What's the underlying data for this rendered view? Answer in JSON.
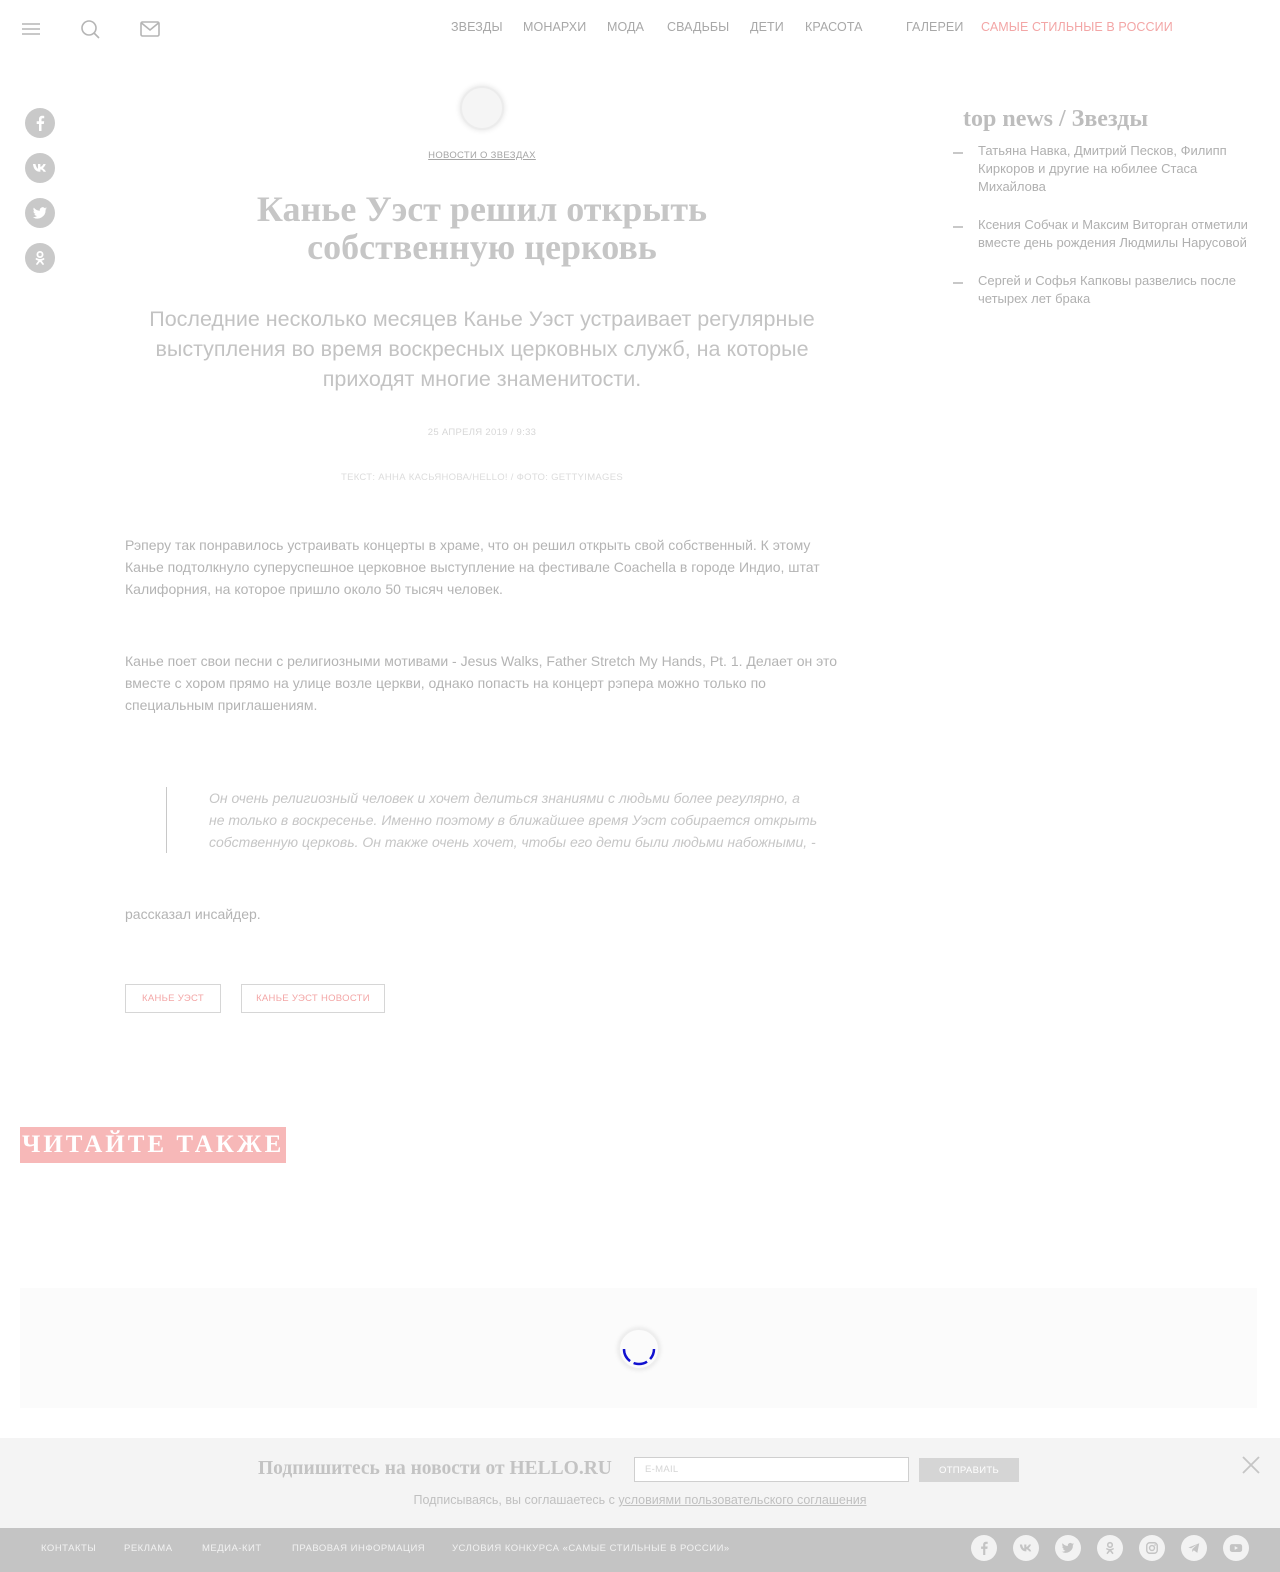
{
  "header": {
    "nav": [
      {
        "label": "ЗВЕЗДЫ",
        "accent": false
      },
      {
        "label": "МОНАРХИ",
        "accent": false
      },
      {
        "label": "МОДА",
        "accent": false
      },
      {
        "label": "СВАДЬБЫ",
        "accent": false
      },
      {
        "label": "ДЕТИ",
        "accent": false
      },
      {
        "label": "КРАСОТА",
        "accent": false
      },
      {
        "label": "ГАЛЕРЕИ",
        "accent": false
      },
      {
        "label": "САМЫЕ СТИЛЬНЫЕ В РОССИИ",
        "accent": true
      }
    ],
    "icons": [
      "menu-icon",
      "search-icon",
      "mail-icon"
    ]
  },
  "share_icons": [
    "facebook-icon",
    "vk-icon",
    "twitter-icon",
    "odnoklassniki-icon"
  ],
  "article": {
    "rubric": "НОВОСТИ О ЗВЕЗДАХ",
    "title": "Канье Уэст решил открыть собственную церковь",
    "lead": "Последние несколько месяцев Канье Уэст устраивает регулярные выступления во время воскресных церковных служб, на которые приходят многие знаменитости.",
    "date": "25 АПРЕЛЯ 2019 / 9:33",
    "credits": "ТЕКСТ: АННА КАСЬЯНОВА/HELLO! / ФОТО: GETTYIMAGES",
    "paragraph_1": "Рэперу так понравилось устраивать концерты в храме, что он решил открыть свой собственный. К этому Канье подтолкнуло суперуспешное церковное выступление на фестивале Coachella в городе Индио, штат Калифорния, на которое пришло около 50 тысяч человек.",
    "paragraph_2": "Канье поет свои песни с религиозными мотивами - Jesus Walks, Father Stretch My Hands, Pt. 1. Делает он это вместе с хором прямо на улице возле церкви, однако попасть на концерт рэпера можно только по специальным приглашениям.",
    "quote": "Он очень религиозный человек и хочет делиться знаниями с людьми более регулярно, а не только в воскресенье. Именно поэтому в ближайшее время Уэст собирается открыть собственную церковь. Он также очень хочет, чтобы его дети были людьми набожными, -",
    "paragraph_3": "рассказал инсайдер.",
    "tags": [
      "КАНЬЕ УЭСТ",
      "КАНЬЕ УЭСТ НОВОСТИ"
    ]
  },
  "top_news": {
    "title": "top news / Звезды",
    "items": [
      "Татьяна Навка, Дмитрий Песков, Филипп Киркоров и другие на юбилее Стаса Михайлова",
      "Ксения Собчак и Максим Виторган отметили вместе день рождения Людмилы Нарусовой",
      "Сергей и Софья Капковы развелись после четырех лет брака"
    ]
  },
  "read_also": "ЧИТАЙТЕ ТАКЖЕ",
  "subscribe": {
    "title": "Подпишитесь на новости от HELLO.RU",
    "email_placeholder": "E-MAIL",
    "button": "ОТПРАВИТЬ",
    "note_prefix": "Подписываясь, вы соглашаетесь с ",
    "note_link": "условиями пользовательского соглашения"
  },
  "footer": {
    "links": [
      "КОНТАКТЫ",
      "РЕКЛАМА",
      "МЕДИА-КИТ",
      "ПРАВОВАЯ ИНФОРМАЦИЯ",
      "УСЛОВИЯ КОНКУРСА «САМЫЕ СТИЛЬНЫЕ В РОССИИ»"
    ],
    "social_icons": [
      "facebook-icon",
      "vk-icon",
      "twitter-icon",
      "odnoklassniki-icon",
      "instagram-icon",
      "telegram-icon",
      "youtube-icon"
    ]
  },
  "colors": {
    "accent": "#f3a6a6",
    "read_also_bg": "#f7b8b8",
    "footer_bg": "#c4c4c4",
    "loader": "#1010d0"
  }
}
